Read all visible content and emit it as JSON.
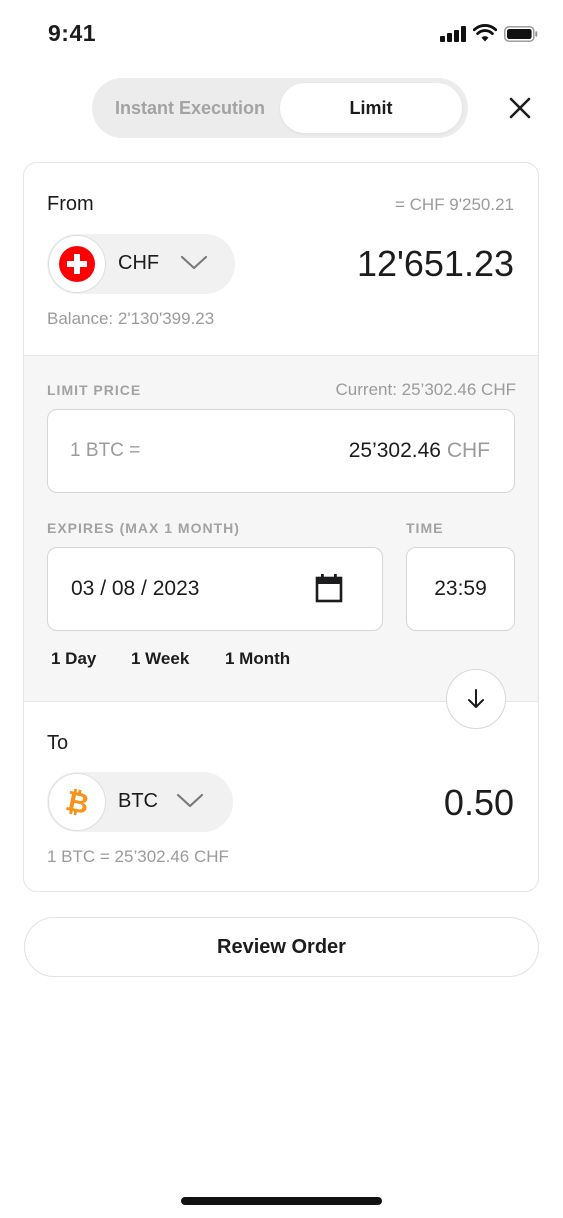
{
  "status_bar": {
    "time": "9:41",
    "icons": [
      "signal-icon",
      "wifi-icon",
      "battery-icon"
    ]
  },
  "mode_toggle": {
    "options": [
      "Instant Execution",
      "Limit"
    ],
    "selected": "Limit"
  },
  "close_icon": "close-icon",
  "from": {
    "label": "From",
    "equivalent": "= CHF 9'250.21",
    "currency": "CHF",
    "currency_icon": "swiss-flag-icon",
    "amount": "12'651.23",
    "balance": "Balance: 2'130'399.23"
  },
  "limit_price": {
    "label": "LIMIT PRICE",
    "current": "Current: 25’302.46 CHF",
    "prefix": "1 BTC =",
    "value": "25’302.46",
    "unit": "CHF"
  },
  "expires": {
    "label": "EXPIRES (MAX 1 MONTH)",
    "date": "03 / 08 / 2023",
    "time_label": "TIME",
    "time": "23:59",
    "quick_options": [
      "1 Day",
      "1 Week",
      "1 Month"
    ]
  },
  "to": {
    "label": "To",
    "currency": "BTC",
    "currency_icon": "bitcoin-icon",
    "amount": "0.50",
    "rate": "1 BTC = 25’302.46 CHF"
  },
  "review_button": "Review Order",
  "colors": {
    "accent_red": "#ff0000",
    "bitcoin_orange": "#f7931a",
    "muted_text": "#9b9b9b"
  }
}
